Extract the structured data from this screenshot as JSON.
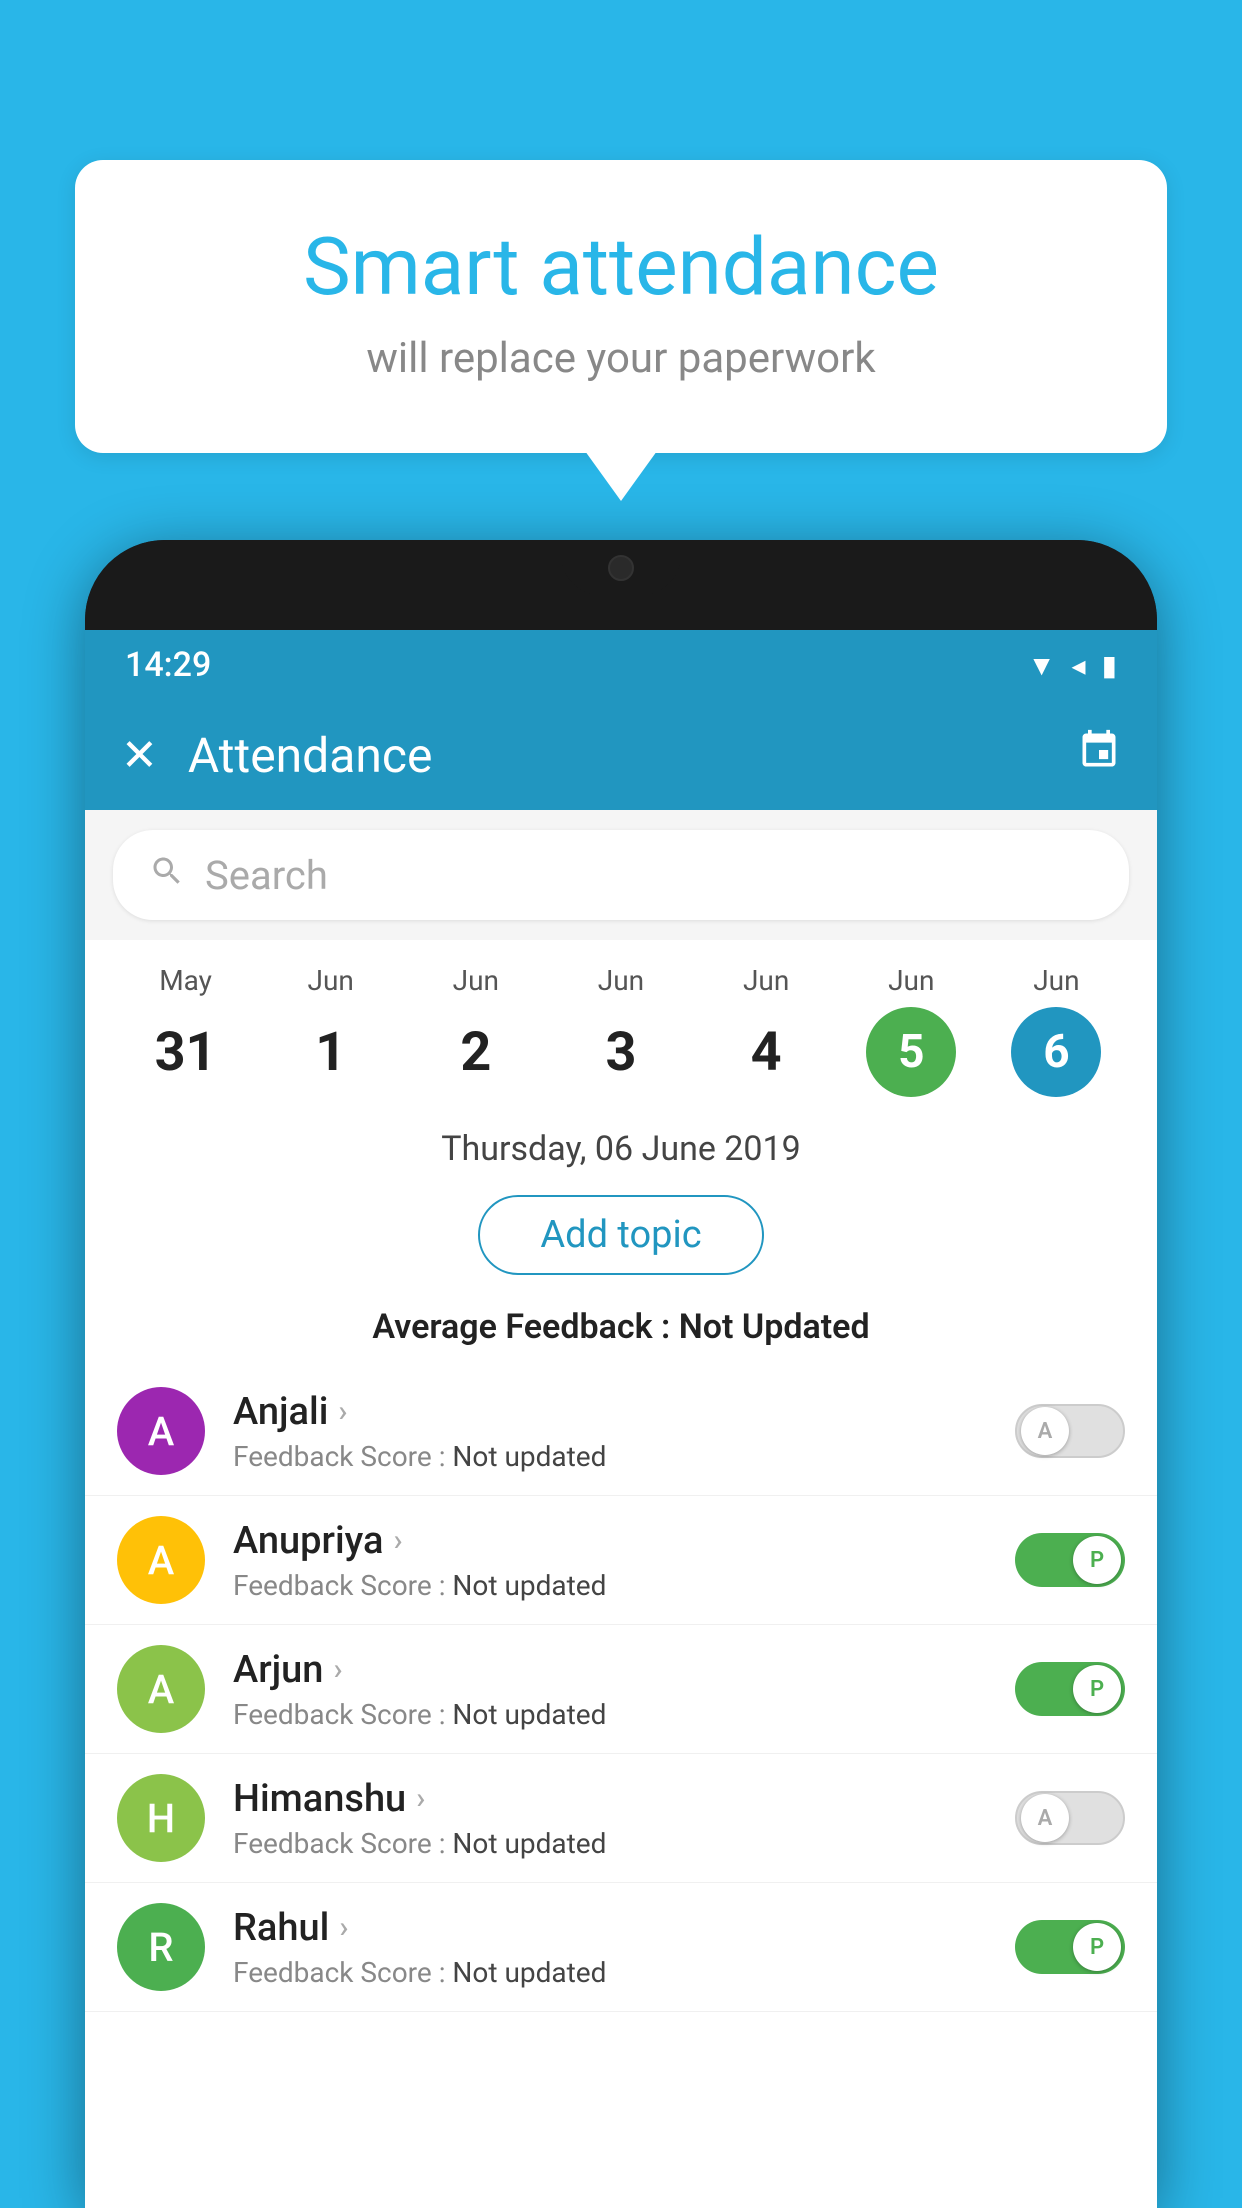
{
  "background_color": "#29b6e8",
  "bubble": {
    "title": "Smart attendance",
    "subtitle": "will replace your paperwork"
  },
  "status_bar": {
    "time": "14:29",
    "wifi": "▲",
    "signal": "▲",
    "battery": "▮"
  },
  "app_bar": {
    "title": "Attendance",
    "close_label": "✕",
    "calendar_icon": "📅"
  },
  "search": {
    "placeholder": "Search"
  },
  "calendar": {
    "days": [
      {
        "month": "May",
        "num": "31",
        "state": "normal"
      },
      {
        "month": "Jun",
        "num": "1",
        "state": "normal"
      },
      {
        "month": "Jun",
        "num": "2",
        "state": "normal"
      },
      {
        "month": "Jun",
        "num": "3",
        "state": "normal"
      },
      {
        "month": "Jun",
        "num": "4",
        "state": "normal"
      },
      {
        "month": "Jun",
        "num": "5",
        "state": "today"
      },
      {
        "month": "Jun",
        "num": "6",
        "state": "selected"
      }
    ]
  },
  "selected_date": "Thursday, 06 June 2019",
  "add_topic_label": "Add topic",
  "avg_feedback_label": "Average Feedback : ",
  "avg_feedback_value": "Not Updated",
  "students": [
    {
      "name": "Anjali",
      "avatar_letter": "A",
      "avatar_color": "#9c27b0",
      "feedback": "Feedback Score : ",
      "feedback_value": "Not updated",
      "toggle_state": "off",
      "toggle_letter": "A"
    },
    {
      "name": "Anupriya",
      "avatar_letter": "A",
      "avatar_color": "#ffc107",
      "feedback": "Feedback Score : ",
      "feedback_value": "Not updated",
      "toggle_state": "on",
      "toggle_letter": "P"
    },
    {
      "name": "Arjun",
      "avatar_letter": "A",
      "avatar_color": "#8bc34a",
      "feedback": "Feedback Score : ",
      "feedback_value": "Not updated",
      "toggle_state": "on",
      "toggle_letter": "P"
    },
    {
      "name": "Himanshu",
      "avatar_letter": "H",
      "avatar_color": "#8bc34a",
      "feedback": "Feedback Score : ",
      "feedback_value": "Not updated",
      "toggle_state": "off",
      "toggle_letter": "A"
    },
    {
      "name": "Rahul",
      "avatar_letter": "R",
      "avatar_color": "#4caf50",
      "feedback": "Feedback Score : ",
      "feedback_value": "Not updated",
      "toggle_state": "on",
      "toggle_letter": "P"
    }
  ]
}
